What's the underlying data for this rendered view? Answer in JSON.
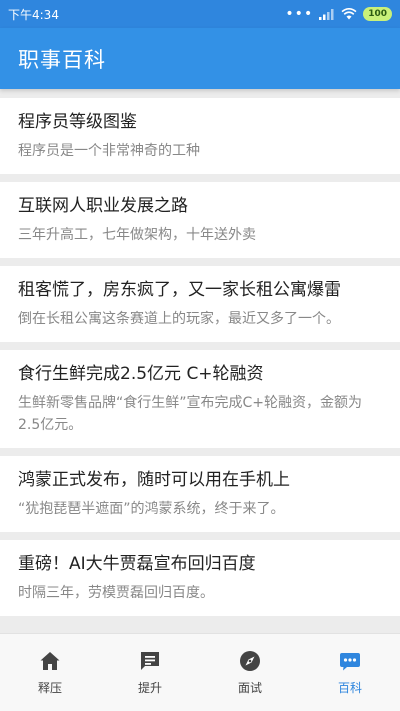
{
  "status_bar": {
    "time": "下午4:34",
    "signal": "•••",
    "battery": "100"
  },
  "app_bar": {
    "title": "职事百科"
  },
  "articles": [
    {
      "title": "程序员等级图鉴",
      "summary": "程序员是一个非常神奇的工种"
    },
    {
      "title": "互联网人职业发展之路",
      "summary": "三年升高工，七年做架构，十年送外卖"
    },
    {
      "title": "租客慌了，房东疯了，又一家长租公寓爆雷",
      "summary": "倒在长租公寓这条赛道上的玩家，最近又多了一个。"
    },
    {
      "title": "食行生鲜完成2.5亿元 C+轮融资",
      "summary": "生鲜新零售品牌“食行生鲜”宣布完成C+轮融资，金额为2.5亿元。"
    },
    {
      "title": "鸿蒙正式发布，随时可以用在手机上",
      "summary": "“犹抱琵琶半遮面”的鸿蒙系统，终于来了。"
    },
    {
      "title": "重磅！AI大牛贾磊宣布回归百度",
      "summary": "时隔三年，劳模贾磊回归百度。"
    }
  ],
  "bottom_nav": {
    "items": [
      {
        "label": "释压",
        "icon": "home-icon"
      },
      {
        "label": "提升",
        "icon": "chat-icon"
      },
      {
        "label": "面试",
        "icon": "compass-icon"
      },
      {
        "label": "百科",
        "icon": "more-bubble-icon"
      }
    ],
    "active_index": 3
  },
  "colors": {
    "status_bar": "#2f86de",
    "app_bar": "#3391e6",
    "active_nav": "#2f86de",
    "inactive_nav": "#444444"
  }
}
